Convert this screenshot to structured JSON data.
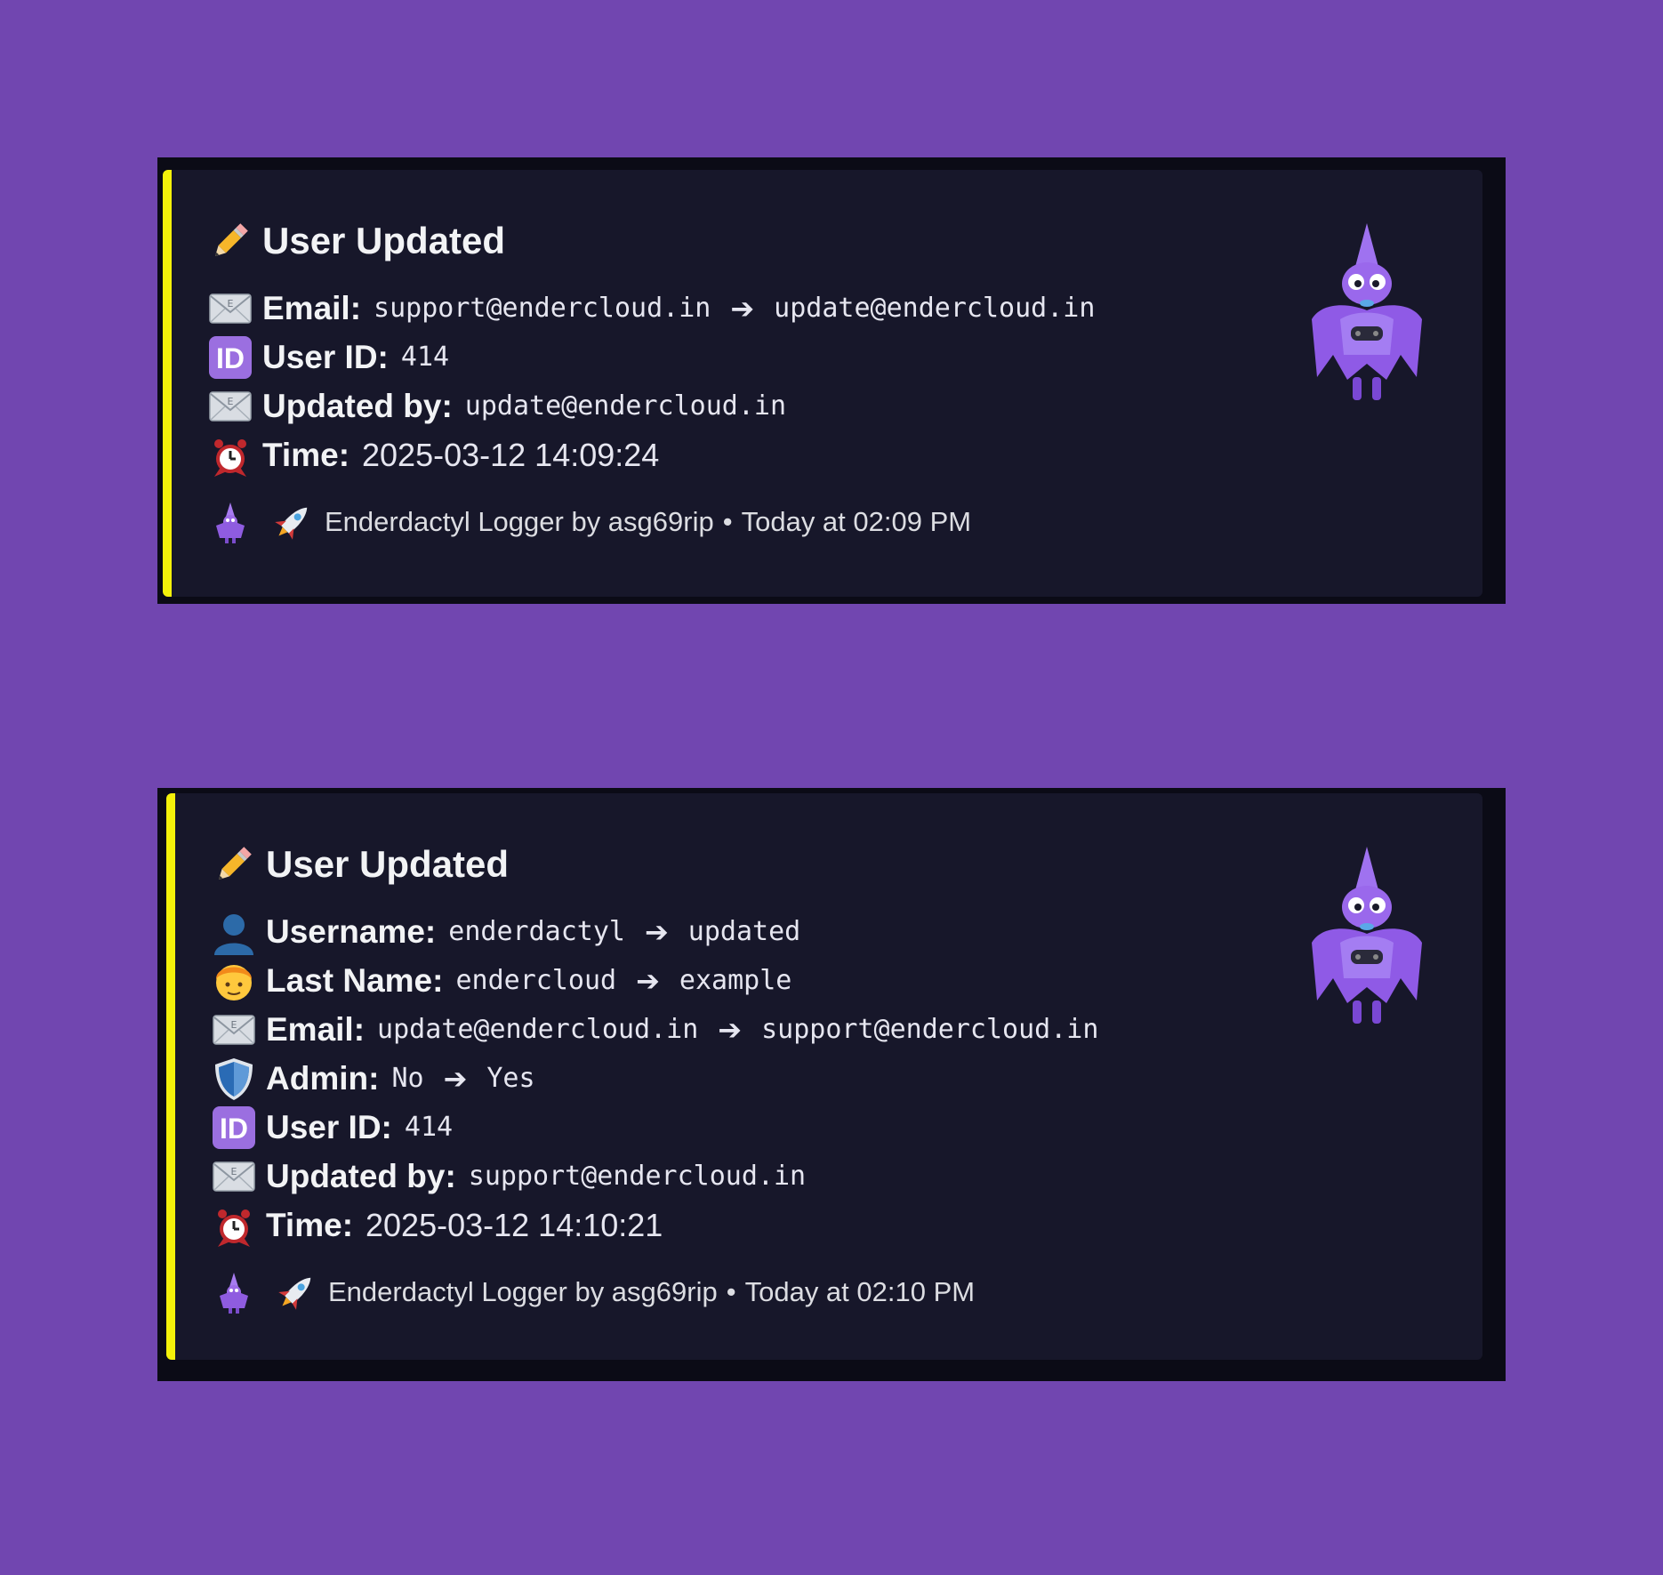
{
  "colors": {
    "background": "#7146b0",
    "panel": "#0b0b16",
    "embed": "#17172a",
    "accent": "#f4f10a"
  },
  "embeds": [
    {
      "title": "User Updated",
      "title_icon": "pencil-icon",
      "fields": {
        "email": {
          "icon": "envelope-icon",
          "label": "Email:",
          "old": "support@endercloud.in",
          "arrow": "➔",
          "new": "update@endercloud.in"
        },
        "user_id": {
          "icon": "id-icon",
          "label": "User ID:",
          "value": "414"
        },
        "updated_by": {
          "icon": "envelope-icon",
          "label": "Updated by:",
          "value": "update@endercloud.in"
        },
        "time": {
          "icon": "alarm-clock-icon",
          "label": "Time:",
          "value": "2025-03-12 14:09:24"
        }
      },
      "footer": {
        "icon": "rocket-icon",
        "text": "Enderdactyl Logger by asg69rip",
        "separator": "•",
        "timestamp": "Today at 02:09 PM"
      },
      "thumbnail_icon": "pterodactyl-mascot-icon"
    },
    {
      "title": "User Updated",
      "title_icon": "pencil-icon",
      "fields": {
        "username": {
          "icon": "user-silhouette-icon",
          "label": "Username:",
          "old": "enderdactyl",
          "arrow": "➔",
          "new": "updated"
        },
        "last_name": {
          "icon": "person-face-icon",
          "label": "Last Name:",
          "old": "endercloud",
          "arrow": "➔",
          "new": "example"
        },
        "email": {
          "icon": "envelope-icon",
          "label": "Email:",
          "old": "update@endercloud.in",
          "arrow": "➔",
          "new": "support@endercloud.in"
        },
        "admin": {
          "icon": "shield-icon",
          "label": "Admin:",
          "old": "No",
          "arrow": "➔",
          "new": "Yes"
        },
        "user_id": {
          "icon": "id-icon",
          "label": "User ID:",
          "value": "414"
        },
        "updated_by": {
          "icon": "envelope-icon",
          "label": "Updated by:",
          "value": "support@endercloud.in"
        },
        "time": {
          "icon": "alarm-clock-icon",
          "label": "Time:",
          "value": "2025-03-12 14:10:21"
        }
      },
      "footer": {
        "icon": "rocket-icon",
        "text": "Enderdactyl Logger by asg69rip",
        "separator": "•",
        "timestamp": "Today at 02:10 PM"
      },
      "thumbnail_icon": "pterodactyl-mascot-icon"
    }
  ]
}
